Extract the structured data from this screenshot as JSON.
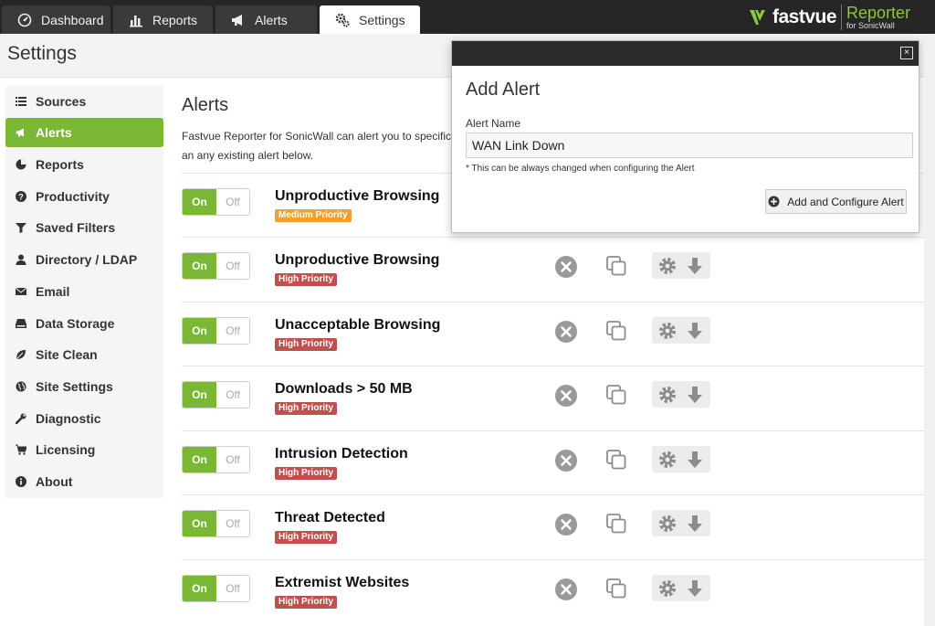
{
  "nav": {
    "tabs": [
      {
        "label": "Dashboard",
        "icon": "gauge-icon",
        "active": false
      },
      {
        "label": "Reports",
        "icon": "bar-chart-icon",
        "active": false
      },
      {
        "label": "Alerts",
        "icon": "megaphone-icon",
        "active": false
      },
      {
        "label": "Settings",
        "icon": "gears-icon",
        "active": true
      }
    ]
  },
  "brand": {
    "name": "fastvue",
    "product": "Reporter",
    "subtitle": "for SonicWall"
  },
  "header": {
    "title": "Settings"
  },
  "sidebar": {
    "items": [
      {
        "label": "Sources",
        "icon": "list-icon"
      },
      {
        "label": "Alerts",
        "icon": "megaphone-icon",
        "active": true
      },
      {
        "label": "Reports",
        "icon": "pie-chart-icon"
      },
      {
        "label": "Productivity",
        "icon": "question-circle-icon"
      },
      {
        "label": "Saved Filters",
        "icon": "filter-icon"
      },
      {
        "label": "Directory / LDAP",
        "icon": "user-icon"
      },
      {
        "label": "Email",
        "icon": "envelope-icon"
      },
      {
        "label": "Data Storage",
        "icon": "hdd-icon"
      },
      {
        "label": "Site Clean",
        "icon": "leaf-icon"
      },
      {
        "label": "Site Settings",
        "icon": "globe-icon"
      },
      {
        "label": "Diagnostic",
        "icon": "wrench-icon"
      },
      {
        "label": "Licensing",
        "icon": "cart-icon"
      },
      {
        "label": "About",
        "icon": "info-circle-icon"
      }
    ]
  },
  "main": {
    "title": "Alerts",
    "description_line1": "Fastvue Reporter for SonicWall can alert you to specific",
    "description_line2": "an any existing alert below."
  },
  "toggle": {
    "on_label": "On",
    "off_label": "Off"
  },
  "alerts": [
    {
      "name": "Unproductive Browsing",
      "priority": "Medium Priority",
      "priority_color": "#f0a030"
    },
    {
      "name": "Unproductive Browsing",
      "priority": "High Priority",
      "priority_color": "#c0504d"
    },
    {
      "name": "Unacceptable Browsing",
      "priority": "High Priority",
      "priority_color": "#c0504d"
    },
    {
      "name": "Downloads > 50 MB",
      "priority": "High Priority",
      "priority_color": "#c0504d"
    },
    {
      "name": "Intrusion Detection",
      "priority": "High Priority",
      "priority_color": "#c0504d"
    },
    {
      "name": "Threat Detected",
      "priority": "High Priority",
      "priority_color": "#c0504d"
    },
    {
      "name": "Extremist Websites",
      "priority": "High Priority",
      "priority_color": "#c0504d"
    }
  ],
  "modal": {
    "title": "Add Alert",
    "close_label": "×",
    "field_label": "Alert Name",
    "field_value": "WAN Link Down",
    "note": "* This can be always changed when configuring the Alert",
    "button_label": "Add and Configure Alert"
  },
  "colors": {
    "accent": "#7ab735",
    "topbar": "#262626",
    "high_priority": "#c0504d",
    "medium_priority": "#f0a030"
  }
}
